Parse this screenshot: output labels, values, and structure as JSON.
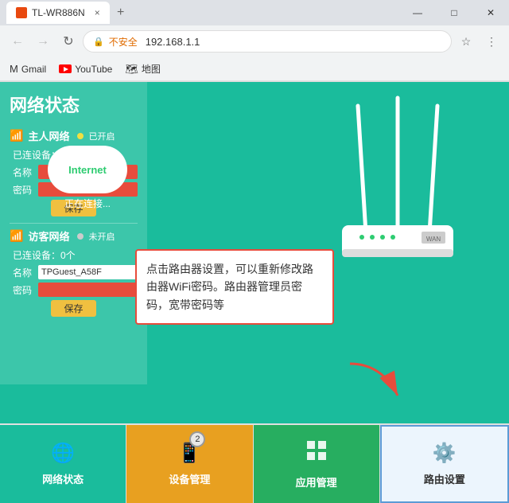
{
  "browser": {
    "tab_title": "TL-WR886N",
    "tab_icon": "router",
    "url": "192.168.1.1",
    "security_label": "不安全",
    "new_tab_label": "+",
    "bookmarks": [
      {
        "id": "gmail",
        "label": "Gmail",
        "icon": "gmail"
      },
      {
        "id": "youtube",
        "label": "YouTube",
        "icon": "youtube"
      },
      {
        "id": "maps",
        "label": "地图",
        "icon": "maps"
      }
    ],
    "window_controls": [
      "minimize",
      "maximize",
      "close"
    ]
  },
  "page": {
    "title": "网络状态",
    "main_network": {
      "label": "主人网络",
      "status": "已开启",
      "connected": "已连设备：2个",
      "name_label": "名称",
      "password_label": "密码",
      "save_btn": "保存"
    },
    "guest_network": {
      "label": "访客网络",
      "status": "未开启",
      "connected": "已连设备：0个",
      "name_value": "TPGuest_A58F",
      "name_label": "名称",
      "password_label": "密码",
      "save_btn": "保存"
    },
    "internet_label": "Internet",
    "connecting_label": "正在连接...",
    "tooltip": "点击路由器设置，可以重新修改路由器WiFi密码。路由器管理员密码，宽带密码等"
  },
  "bottom_nav": [
    {
      "id": "network",
      "label": "网络状态",
      "icon": "🌐"
    },
    {
      "id": "device",
      "label": "设备管理",
      "icon": "📱",
      "badge": "2"
    },
    {
      "id": "app",
      "label": "应用管理",
      "icon": "📦"
    },
    {
      "id": "router",
      "label": "路由设置",
      "icon": "⚙️",
      "active": true
    }
  ],
  "icons": {
    "wifi": "📶",
    "gear": "⚙️",
    "globe": "🌐",
    "arrow": "→",
    "back": "←",
    "forward": "→",
    "reload": "↻",
    "star": "☆",
    "menu": "⋮"
  }
}
